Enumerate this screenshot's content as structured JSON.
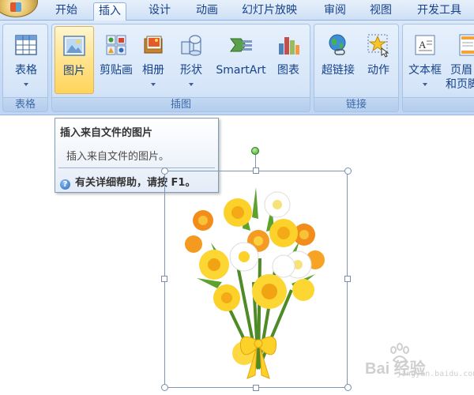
{
  "tabs": [
    "开始",
    "插入",
    "设计",
    "动画",
    "幻灯片放映",
    "审阅",
    "视图",
    "开发工具"
  ],
  "active_tab": "插入",
  "ribbon": {
    "groups": {
      "table": {
        "label": "表格",
        "buttons": [
          "表格"
        ]
      },
      "illustrations": {
        "label": "插图",
        "buttons": [
          "图片",
          "剪贴画",
          "相册",
          "形状",
          "SmartArt",
          "图表"
        ]
      },
      "links": {
        "label": "链接",
        "buttons": [
          "超链接",
          "动作"
        ]
      },
      "text": {
        "buttons": [
          "文本框",
          "页眉",
          "和页脚"
        ]
      }
    },
    "pressed_button": "图片"
  },
  "tooltip": {
    "title": "插入来自文件的图片",
    "body": "插入来自文件的图片。",
    "help": "有关详细帮助，请按 F1。",
    "help_icon": "?"
  },
  "slide": {
    "image_name": "daffodil-bouquet",
    "selected": true
  },
  "watermark": {
    "brand": "Bai 经验",
    "url": "jingyan.baidu.com"
  },
  "colors": {
    "ribbon_bg": "#c9dcf4",
    "pressed": "#ffd45c",
    "text": "#15428b"
  }
}
